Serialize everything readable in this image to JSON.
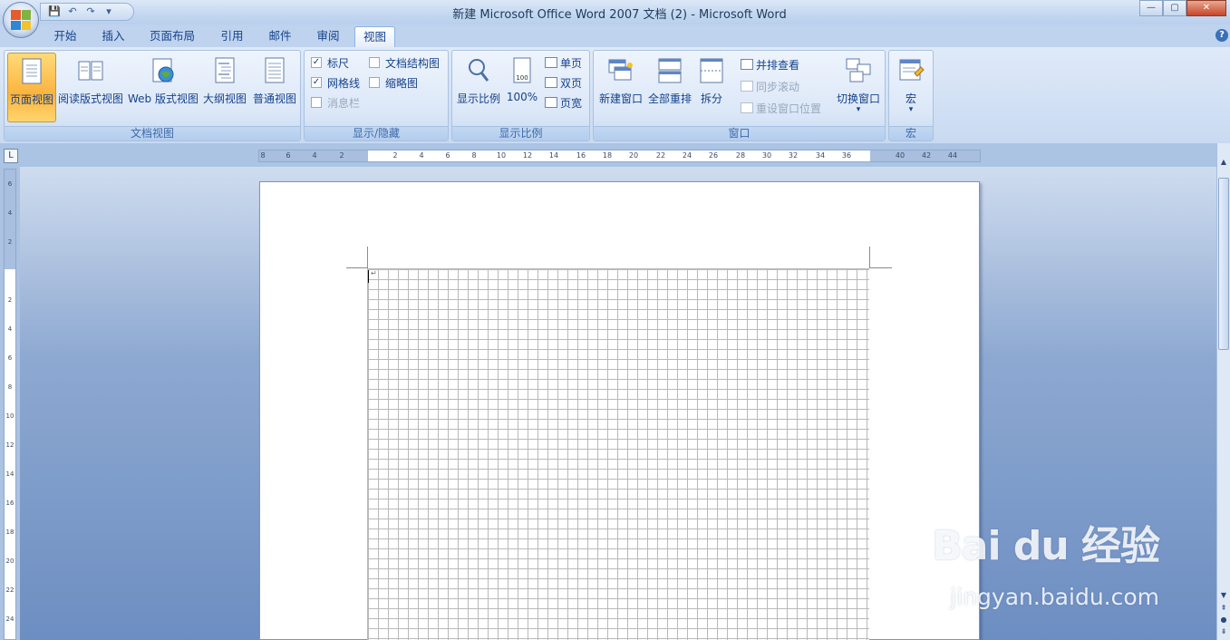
{
  "window": {
    "title": "新建 Microsoft Office Word 2007 文档 (2) - Microsoft Word",
    "min": "—",
    "restore": "▢",
    "close": "✕"
  },
  "qat": {
    "save": "💾",
    "undo": "↶",
    "redo": "↷",
    "customize": "▾"
  },
  "tabs": [
    "开始",
    "插入",
    "页面布局",
    "引用",
    "邮件",
    "审阅",
    "视图"
  ],
  "active_tab": "视图",
  "help": "?",
  "groups": {
    "doc_views": {
      "label": "文档视图",
      "buttons": [
        "页面视图",
        "阅读版式视图",
        "Web 版式视图",
        "大纲视图",
        "普通视图"
      ]
    },
    "show_hide": {
      "label": "显示/隐藏",
      "ruler": "标尺",
      "ruler_checked": true,
      "gridlines": "网格线",
      "gridlines_checked": true,
      "message_bar": "消息栏",
      "message_bar_checked": false,
      "doc_map": "文档结构图",
      "doc_map_checked": false,
      "thumbnails": "缩略图",
      "thumbnails_checked": false,
      "check": "✓"
    },
    "zoom": {
      "label": "显示比例",
      "zoom_btn": "显示比例",
      "percent_btn": "100%",
      "one_page": "单页",
      "two_pages": "双页",
      "page_width": "页宽",
      "icon_100": "100"
    },
    "window": {
      "label": "窗口",
      "new_window": "新建窗口",
      "arrange_all": "全部重排",
      "split": "拆分",
      "side_by_side": "并排查看",
      "sync_scroll": "同步滚动",
      "reset_position": "重设窗口位置",
      "switch_windows": "切换窗口",
      "dropdown": "▾"
    },
    "macros": {
      "label": "宏",
      "macros_btn": "宏",
      "dropdown": "▾"
    }
  },
  "ruler_h_labels": [
    "8",
    "6",
    "4",
    "2",
    "2",
    "4",
    "6",
    "8",
    "10",
    "12",
    "14",
    "16",
    "18",
    "20",
    "22",
    "24",
    "26",
    "28",
    "30",
    "32",
    "34",
    "36",
    "40",
    "42",
    "44"
  ],
  "ruler_v_labels": [
    "6",
    "4",
    "2",
    "2",
    "4",
    "6",
    "8",
    "10",
    "12",
    "14",
    "16",
    "18",
    "20",
    "22",
    "24"
  ],
  "tab_selector": "L",
  "paragraph_mark": "↵",
  "watermark": {
    "logo": "Bai du 经验",
    "url": "jingyan.baidu.com"
  },
  "colors": {
    "accent": "#15428b",
    "ribbon_bg": "#dbe7f7",
    "selected": "#fbb33d"
  }
}
